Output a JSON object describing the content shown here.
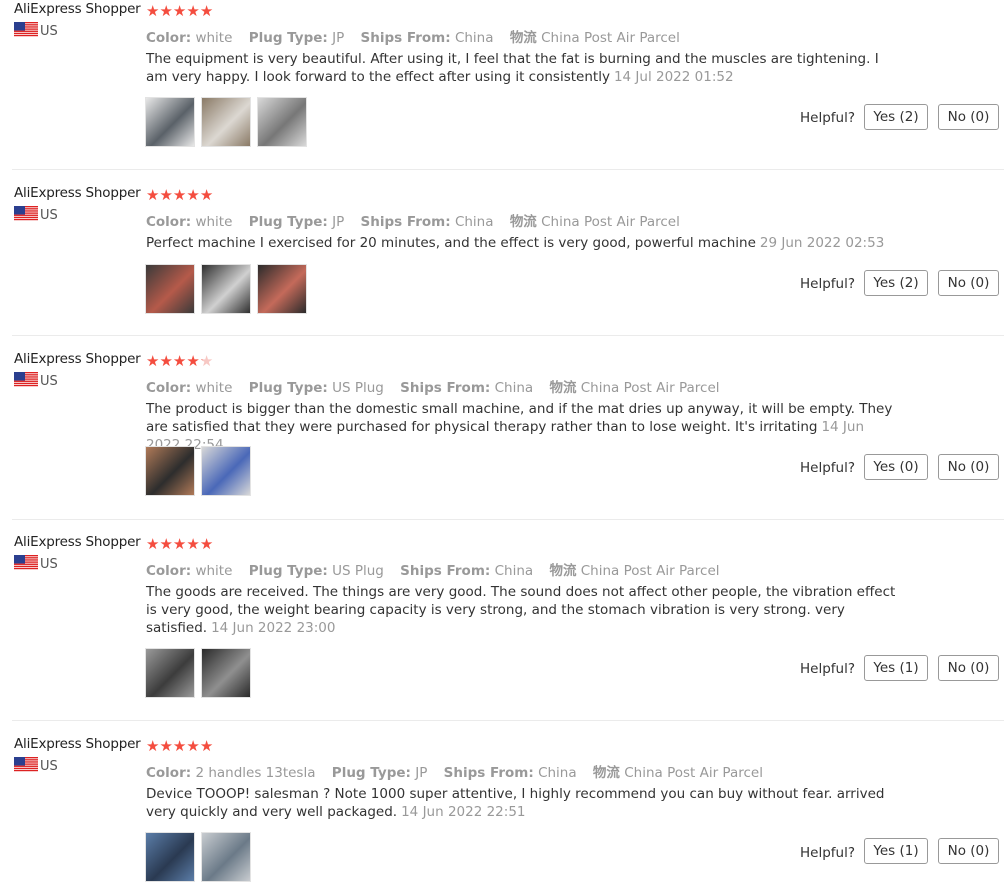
{
  "labels": {
    "color": "Color:",
    "plug_type": "Plug Type:",
    "ships_from": "Ships From:",
    "logistics": "物流",
    "helpful": "Helpful?"
  },
  "reviews": [
    {
      "author": "AliExpress Shopper",
      "rating": 5,
      "country": "US",
      "color": "white",
      "plug_type": "JP",
      "ships_from": "China",
      "logistics": "China Post Air Parcel",
      "text": "The equipment is very beautiful. After using it, I feel that the fat is burning and the muscles are tightening. I am very happy. I look forward to the effect after using it consistently",
      "date": "14 Jul 2022 01:52",
      "photos": [
        {
          "name": "white-device-console-photo",
          "colors": [
            "#e8e8e8",
            "#5a6168"
          ]
        },
        {
          "name": "device-handle-photo",
          "colors": [
            "#8a7a66",
            "#dcd8d2"
          ]
        },
        {
          "name": "handle-applicator-photo",
          "colors": [
            "#d9d9d9",
            "#777"
          ]
        }
      ],
      "yes": "Yes (2)",
      "no": "No (0)"
    },
    {
      "author": "AliExpress Shopper",
      "rating": 5,
      "country": "US",
      "color": "white",
      "plug_type": "JP",
      "ships_from": "China",
      "logistics": "China Post Air Parcel",
      "text": "Perfect machine I exercised for 20 minutes, and the effect is very good, powerful machine",
      "date": "29 Jun 2022 02:53",
      "photos": [
        {
          "name": "control-screen-photo",
          "colors": [
            "#3a3a3a",
            "#b55a4a"
          ]
        },
        {
          "name": "handle-closeup-photo",
          "colors": [
            "#2f2f2f",
            "#d0d0d0"
          ]
        },
        {
          "name": "display-panel-photo",
          "colors": [
            "#2b2b2b",
            "#c46a5a"
          ]
        }
      ],
      "yes": "Yes (2)",
      "no": "No (0)"
    },
    {
      "author": "AliExpress Shopper",
      "rating": 4.2,
      "country": "US",
      "color": "white",
      "plug_type": "US Plug",
      "ships_from": "China",
      "logistics": "China Post Air Parcel",
      "text": "The product is bigger than the domestic small machine, and if the mat dries up anyway, it will be empty. They are satisfied that they were purchased for physical therapy rather than to lose weight. It's irritating",
      "date": "14 Jun 2022 22:54",
      "photos": [
        {
          "name": "device-in-use-photo",
          "colors": [
            "#b07a58",
            "#2d2d2d"
          ]
        },
        {
          "name": "blue-screen-device-photo",
          "colors": [
            "#d8d8d8",
            "#4a68b8"
          ]
        }
      ],
      "yes": "Yes (0)",
      "no": "No (0)"
    },
    {
      "author": "AliExpress Shopper",
      "rating": 5,
      "country": "US",
      "color": "white",
      "plug_type": "US Plug",
      "ships_from": "China",
      "logistics": "China Post Air Parcel",
      "text": "The goods are received. The things are very good. The sound does not affect other people, the vibration effect is very good, the weight bearing capacity is very strong, and the stomach vibration is very strong. very satisfied.",
      "date": "14 Jun 2022 23:00",
      "photos": [
        {
          "name": "handles-box-photo",
          "colors": [
            "#9a9a9a",
            "#3c3c3c"
          ]
        },
        {
          "name": "device-screen-photo",
          "colors": [
            "#2a2a2a",
            "#8f8f8f"
          ]
        }
      ],
      "yes": "Yes (1)",
      "no": "No (0)"
    },
    {
      "author": "AliExpress Shopper",
      "rating": 5,
      "country": "US",
      "color": "2 handles 13tesla",
      "plug_type": "JP",
      "ships_from": "China",
      "logistics": "China Post Air Parcel",
      "text": "Device TOOOP! salesman ? Note 1000 super attentive, I highly recommend you can buy without fear. arrived very quickly and very well packaged.",
      "date": "14 Jun 2022 22:51",
      "photos": [
        {
          "name": "touchscreen-photo",
          "colors": [
            "#5b7da8",
            "#2a3a52"
          ]
        },
        {
          "name": "device-front-photo",
          "colors": [
            "#c8ccd0",
            "#6b7a88"
          ]
        }
      ],
      "yes": "Yes (1)",
      "no": "No (0)"
    }
  ]
}
